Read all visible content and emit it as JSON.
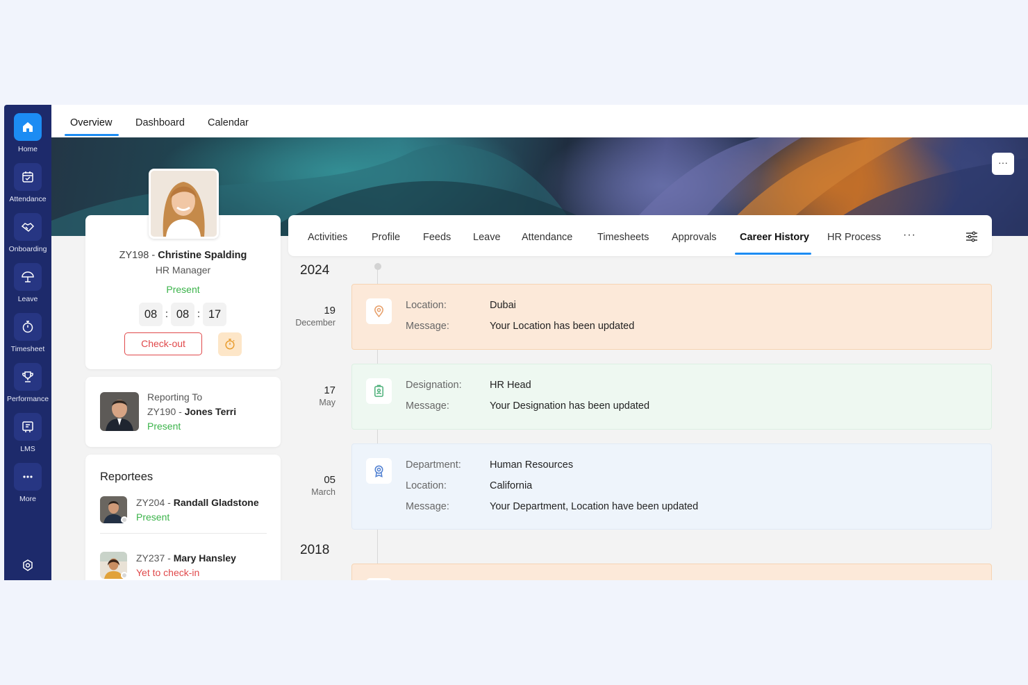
{
  "sidebar": {
    "items": [
      {
        "label": "Home",
        "icon": "home-icon",
        "active": true
      },
      {
        "label": "Attendance",
        "icon": "calendar-check-icon"
      },
      {
        "label": "Onboarding",
        "icon": "handshake-icon"
      },
      {
        "label": "Leave",
        "icon": "umbrella-icon"
      },
      {
        "label": "Timesheet",
        "icon": "timer-icon"
      },
      {
        "label": "Performance",
        "icon": "trophy-icon"
      },
      {
        "label": "LMS",
        "icon": "book-icon"
      },
      {
        "label": "More",
        "icon": "more-dots-icon"
      }
    ],
    "bottom_icon": "settings-icon"
  },
  "top_tabs": [
    "Overview",
    "Dashboard",
    "Calendar"
  ],
  "banner": {
    "more": "···"
  },
  "profile": {
    "id": "ZY198",
    "separator": " - ",
    "name": "Christine Spalding",
    "role": "HR Manager",
    "status": "Present",
    "timer": {
      "h": "08",
      "m": "08",
      "s": "17",
      "sep": ":"
    },
    "checkout_label": "Check-out"
  },
  "reporting": {
    "label": "Reporting To",
    "id": "ZY190",
    "name": "Jones Terri",
    "status": "Present"
  },
  "reportees": {
    "title": "Reportees",
    "items": [
      {
        "id": "ZY204",
        "name": "Randall Gladstone",
        "status": "Present"
      },
      {
        "id": "ZY237",
        "name": "Mary Hansley",
        "status": "Yet to check-in"
      }
    ]
  },
  "tabs": {
    "items": [
      "Activities",
      "Profile",
      "Feeds",
      "Leave",
      "Attendance",
      "Timesheets",
      "Approvals",
      "Career History",
      "HR Process"
    ],
    "more": "···",
    "active": "Career History"
  },
  "timeline": {
    "years": [
      "2024",
      "2018"
    ],
    "entries": [
      {
        "day": "19",
        "month": "December",
        "kind": "location",
        "rows": [
          {
            "k": "Location:",
            "v": "Dubai"
          },
          {
            "k": "Message:",
            "v": "Your Location has been updated"
          }
        ]
      },
      {
        "day": "17",
        "month": "May",
        "kind": "designation",
        "rows": [
          {
            "k": "Designation:",
            "v": "HR Head"
          },
          {
            "k": "Message:",
            "v": "Your Designation has been updated"
          }
        ]
      },
      {
        "day": "05",
        "month": "March",
        "kind": "department",
        "rows": [
          {
            "k": "Department:",
            "v": "Human Resources"
          },
          {
            "k": "Location:",
            "v": "California"
          },
          {
            "k": "Message:",
            "v": "Your Department, Location have been updated"
          }
        ]
      }
    ]
  },
  "colors": {
    "sidebar": "#1d2a6b",
    "accent": "#1c8cf3",
    "present": "#3bb34a",
    "absent": "#e0484a",
    "location_bg": "#fce9d9",
    "designation_bg": "#eef8f1",
    "department_bg": "#eef4fb"
  }
}
